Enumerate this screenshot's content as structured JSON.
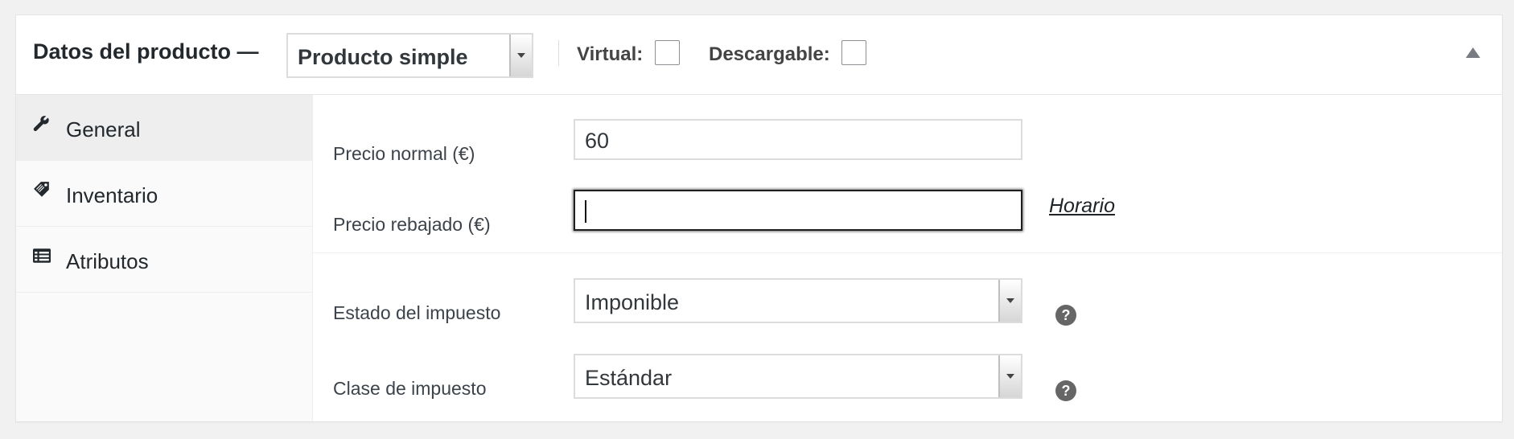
{
  "header": {
    "title": "Datos del producto —",
    "product_type": "Producto simple",
    "virtual_label": "Virtual:",
    "downloadable_label": "Descargable:"
  },
  "tabs": [
    {
      "label": "General",
      "icon": "wrench-icon",
      "active": true
    },
    {
      "label": "Inventario",
      "icon": "tag-icon",
      "active": false
    },
    {
      "label": "Atributos",
      "icon": "list-icon",
      "active": false
    }
  ],
  "general": {
    "regular_price_label": "Precio normal (€)",
    "regular_price_value": "60",
    "sale_price_label": "Precio rebajado (€)",
    "sale_price_value": "",
    "schedule_link": "Horario",
    "tax_status_label": "Estado del impuesto",
    "tax_status_value": "Imponible",
    "tax_class_label": "Clase de impuesto",
    "tax_class_value": "Estándar",
    "help_glyph": "?"
  },
  "colors": {
    "background": "#f1f1f1",
    "panel": "#ffffff",
    "active_tab": "#eeeeee",
    "help_badge": "#666666"
  }
}
